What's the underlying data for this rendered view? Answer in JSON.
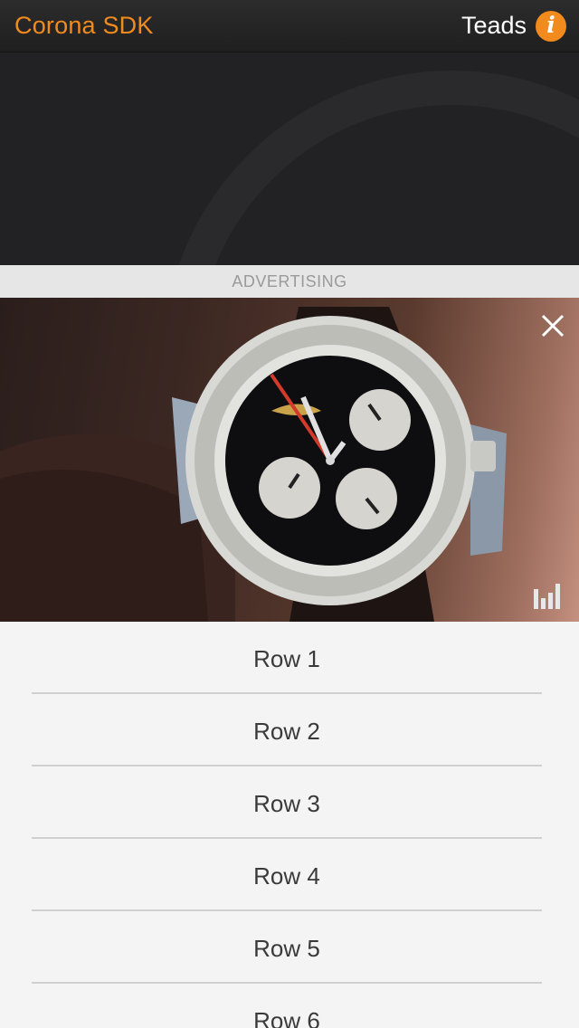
{
  "header": {
    "app_title": "Corona SDK",
    "provider_label": "Teads",
    "info_icon": "info-icon"
  },
  "ad": {
    "label": "ADVERTISING",
    "close_icon": "close-icon",
    "stats_icon": "bar-chart-icon",
    "media": "wristwatch-chronograph-video"
  },
  "list": {
    "rows": [
      {
        "label": "Row 1"
      },
      {
        "label": "Row 2"
      },
      {
        "label": "Row 3"
      },
      {
        "label": "Row 4"
      },
      {
        "label": "Row 5"
      },
      {
        "label": "Row 6"
      }
    ]
  },
  "colors": {
    "accent": "#f28b1e",
    "topbar": "#262626",
    "hero": "#222224",
    "ad_label_bg": "#e6e6e6",
    "list_bg": "#f4f4f4",
    "divider": "#cfcfcf"
  }
}
